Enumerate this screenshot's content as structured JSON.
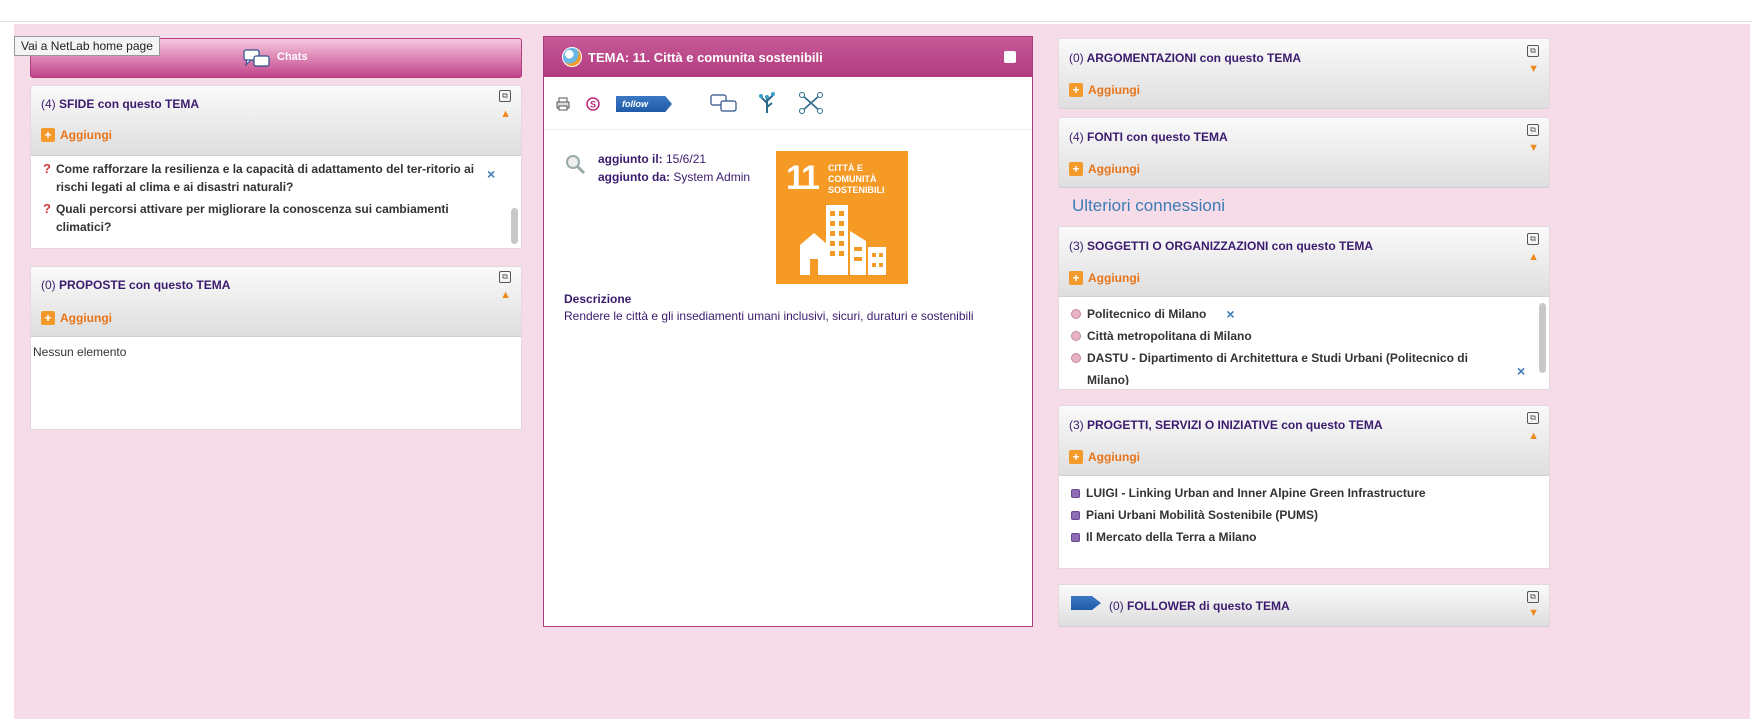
{
  "tooltip": "Vai a NetLab home page",
  "chats": {
    "label": "Chats"
  },
  "left": {
    "sfide": {
      "count": "(4)",
      "title": "SFIDE con questo TEMA",
      "add": "Aggiungi",
      "items": [
        "Come rafforzare la resilienza e la capacità di adattamento del ter-ritorio ai rischi legati al clima e ai disastri naturali?",
        "Quali percorsi attivare per migliorare la conoscenza sui cambiamenti climatici?"
      ],
      "remove_icon": "×"
    },
    "proposte": {
      "count": "(0)",
      "title": "PROPOSTE con questo TEMA",
      "add": "Aggiungi",
      "empty": "Nessun elemento"
    }
  },
  "center": {
    "title": "TEMA: 11. Città e comunita sostenibili",
    "follow": "follow",
    "added_on_label": "aggiunto il:",
    "added_on_value": "15/6/21",
    "added_by_label": "aggiunto da:",
    "added_by_value": "System Admin",
    "sdg": {
      "number": "11",
      "text_line1": "CITTÀ E COMUNITÀ",
      "text_line2": "SOSTENIBILI",
      "color": "#f59a24"
    },
    "description_label": "Descrizione",
    "description": "Rendere le città e gli insediamenti umani inclusivi, sicuri, duraturi e sostenibili"
  },
  "right": {
    "argomentazioni": {
      "count": "(0)",
      "title": "ARGOMENTAZIONI con questo TEMA",
      "add": "Aggiungi"
    },
    "fonti": {
      "count": "(4)",
      "title": "FONTI con questo TEMA",
      "add": "Aggiungi"
    },
    "section_title": "Ulteriori connessioni",
    "soggetti": {
      "count": "(3)",
      "title": "SOGGETTI O ORGANIZZAZIONI con questo TEMA",
      "add": "Aggiungi",
      "items": [
        "Politecnico di Milano",
        "Città metropolitana di Milano",
        "DASTU - Dipartimento di Architettura e Studi Urbani (Politecnico di Milano)"
      ],
      "remove_icon": "×"
    },
    "progetti": {
      "count": "(3)",
      "title": "PROGETTI, SERVIZI O INIZIATIVE con questo TEMA",
      "add": "Aggiungi",
      "items": [
        "LUIGI - Linking Urban and Inner Alpine Green Infrastructure",
        "Piani Urbani Mobilità Sostenibile (PUMS)",
        "Il Mercato della Terra a Milano"
      ]
    },
    "follower": {
      "count": "(0)",
      "title": "FOLLOWER di questo TEMA"
    }
  },
  "colors": {
    "accent": "#b23b80",
    "link": "#3c7cb5",
    "orange": "#e8741a",
    "background": "#f6dbe9"
  }
}
